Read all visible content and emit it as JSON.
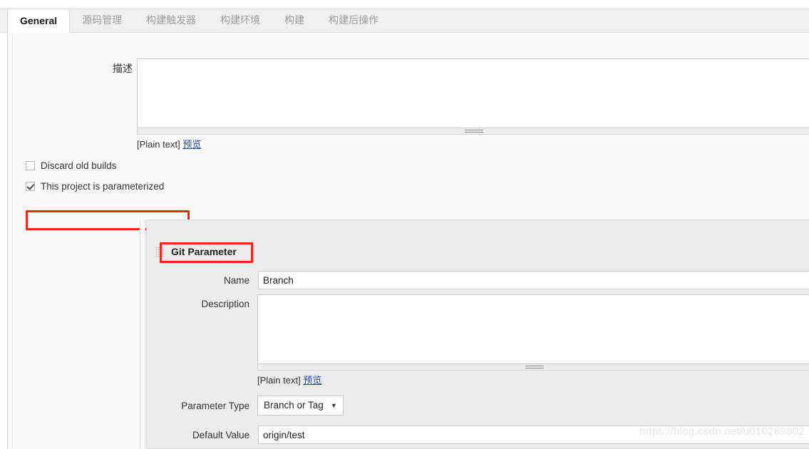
{
  "tabs": [
    {
      "label": "General",
      "active": true
    },
    {
      "label": "源码管理",
      "active": false
    },
    {
      "label": "构建触发器",
      "active": false
    },
    {
      "label": "构建环境",
      "active": false
    },
    {
      "label": "构建",
      "active": false
    },
    {
      "label": "构建后操作",
      "active": false
    }
  ],
  "description_row": {
    "label": "描述",
    "value": "",
    "markup_note": "[Plain text]",
    "preview_link": "预览"
  },
  "checkboxes": [
    {
      "label": "Discard old builds",
      "checked": false
    },
    {
      "label": "This project is parameterized",
      "checked": true
    }
  ],
  "git_parameter": {
    "title": "Git Parameter",
    "grip_icon": "drag-grip-icon",
    "name": {
      "label": "Name",
      "value": "Branch"
    },
    "description": {
      "label": "Description",
      "value": "",
      "markup_note": "[Plain text]",
      "preview_link": "预览"
    },
    "parameter_type": {
      "label": "Parameter Type",
      "value": "Branch or Tag",
      "caret": "▼"
    },
    "default_value": {
      "label": "Default Value",
      "value": "origin/test"
    }
  },
  "watermark": "https://blog.csdn.net/u010289802",
  "colors": {
    "annotation": "#f22a11",
    "link": "#2a4b8d",
    "panel_bg": "#ececec",
    "page_bg": "#fafafa",
    "tabbar_bg": "#f0f0f0"
  }
}
